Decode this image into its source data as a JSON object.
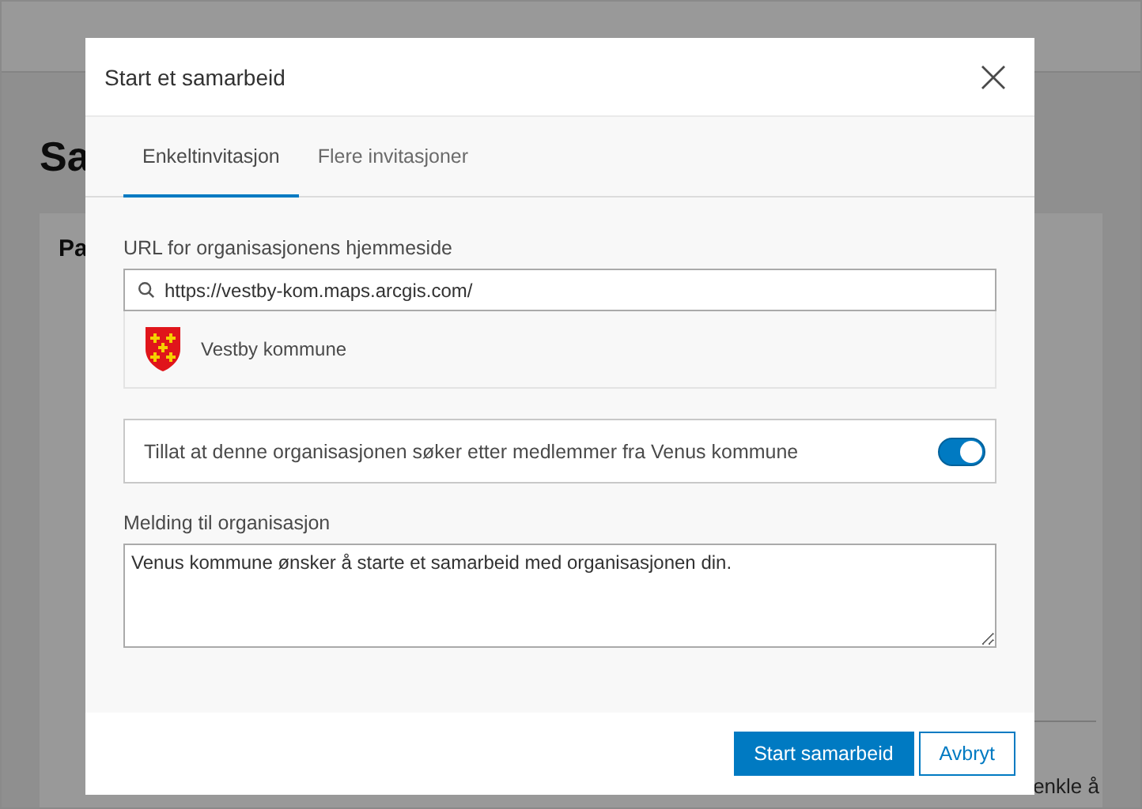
{
  "page": {
    "heading": "Sa",
    "panel_title": "Pa",
    "panel_text": "enkle å"
  },
  "dialog": {
    "title": "Start et samarbeid",
    "tabs": [
      {
        "label": "Enkeltinvitasjon",
        "selected": true
      },
      {
        "label": "Flere invitasjoner",
        "selected": false
      }
    ],
    "url_label": "URL for organisasjonens hjemmeside",
    "url_value": "https://vestby-kom.maps.arcgis.com/",
    "result": {
      "name": "Vestby kommune"
    },
    "allow_search": {
      "label": "Tillat at denne organisasjonen søker etter medlemmer fra Venus kommune",
      "on": true
    },
    "message_label": "Melding til organisasjon",
    "message_value": "Venus kommune ønsker å starte et samarbeid med organisasjonen din.",
    "buttons": [
      {
        "label": "Start samarbeid",
        "kind": "primary"
      },
      {
        "label": "Avbryt",
        "kind": "secondary"
      }
    ]
  }
}
